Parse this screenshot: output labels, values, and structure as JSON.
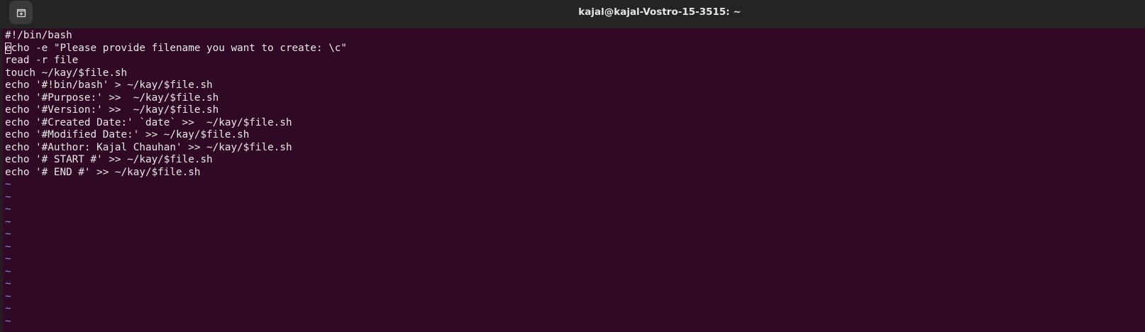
{
  "window": {
    "title": "kajal@kajal-Vostro-15-3515: ~"
  },
  "titlebar": {
    "new_tab_icon": "new-tab-icon"
  },
  "editor": {
    "cursor_char": "e",
    "first_line": "#!/bin/bash",
    "cursor_line_rest": "cho -e \"Please provide filename you want to create: \\c\"",
    "lines": [
      "read -r file",
      "touch ~/kay/$file.sh",
      "echo '#!bin/bash' > ~/kay/$file.sh",
      "echo '#Purpose:' >>  ~/kay/$file.sh",
      "echo '#Version:' >>  ~/kay/$file.sh",
      "echo '#Created Date:' `date` >>  ~/kay/$file.sh",
      "echo '#Modified Date:' >> ~/kay/$file.sh",
      "echo '#Author: Kajal Chauhan' >> ~/kay/$file.sh",
      "echo '# START #' >> ~/kay/$file.sh",
      "echo '# END #' >> ~/kay/$file.sh"
    ],
    "tildes": [
      "~",
      "~",
      "~",
      "~",
      "~",
      "~",
      "~",
      "~",
      "~",
      "~",
      "~",
      "~"
    ]
  },
  "colors": {
    "terminal_bg": "#300a24",
    "titlebar_bg": "#242424",
    "text": "#e8e8e8",
    "tilde": "#8a8ae6"
  }
}
